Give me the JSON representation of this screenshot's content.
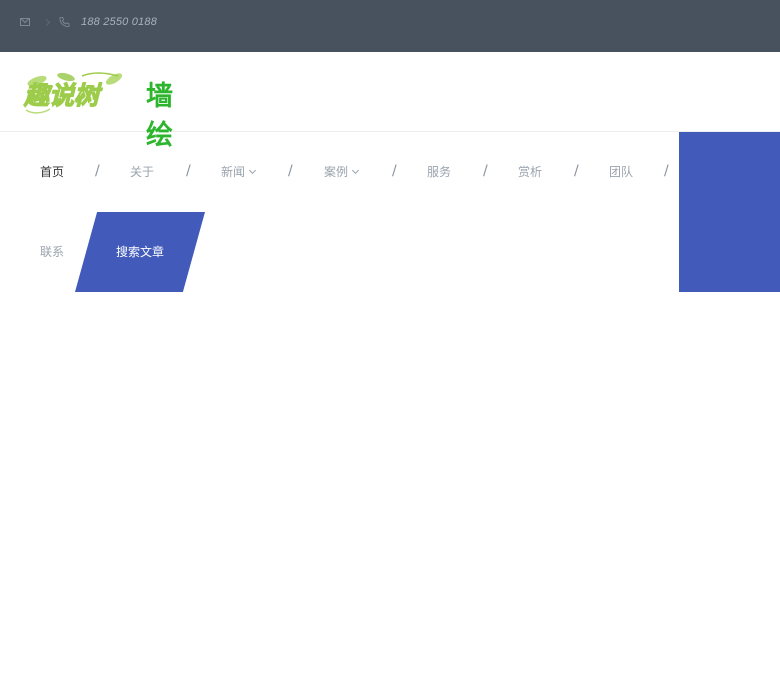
{
  "topbar": {
    "mail_icon": "mail-icon",
    "phone_icon": "phone-icon",
    "phone": "188 2550 0188"
  },
  "header": {
    "logo_text": "趣说树",
    "brand": "墙绘",
    "colors": {
      "brand_green": "#2db52d",
      "logo_green": "#9ccc4a"
    }
  },
  "nav": {
    "items": [
      {
        "label": "首页",
        "active": true
      },
      {
        "label": "关于"
      },
      {
        "label": "新闻",
        "dropdown": true
      },
      {
        "label": "案例",
        "dropdown": true
      },
      {
        "label": "服务"
      },
      {
        "label": "赏析"
      },
      {
        "label": "团队"
      },
      {
        "label": "联系"
      }
    ],
    "separator": "/",
    "search_label": "搜索文章"
  },
  "colors": {
    "topbar_bg": "#48525f",
    "accent_blue": "#425bbb",
    "nav_text": "#9aa3ad",
    "nav_active": "#333333"
  }
}
